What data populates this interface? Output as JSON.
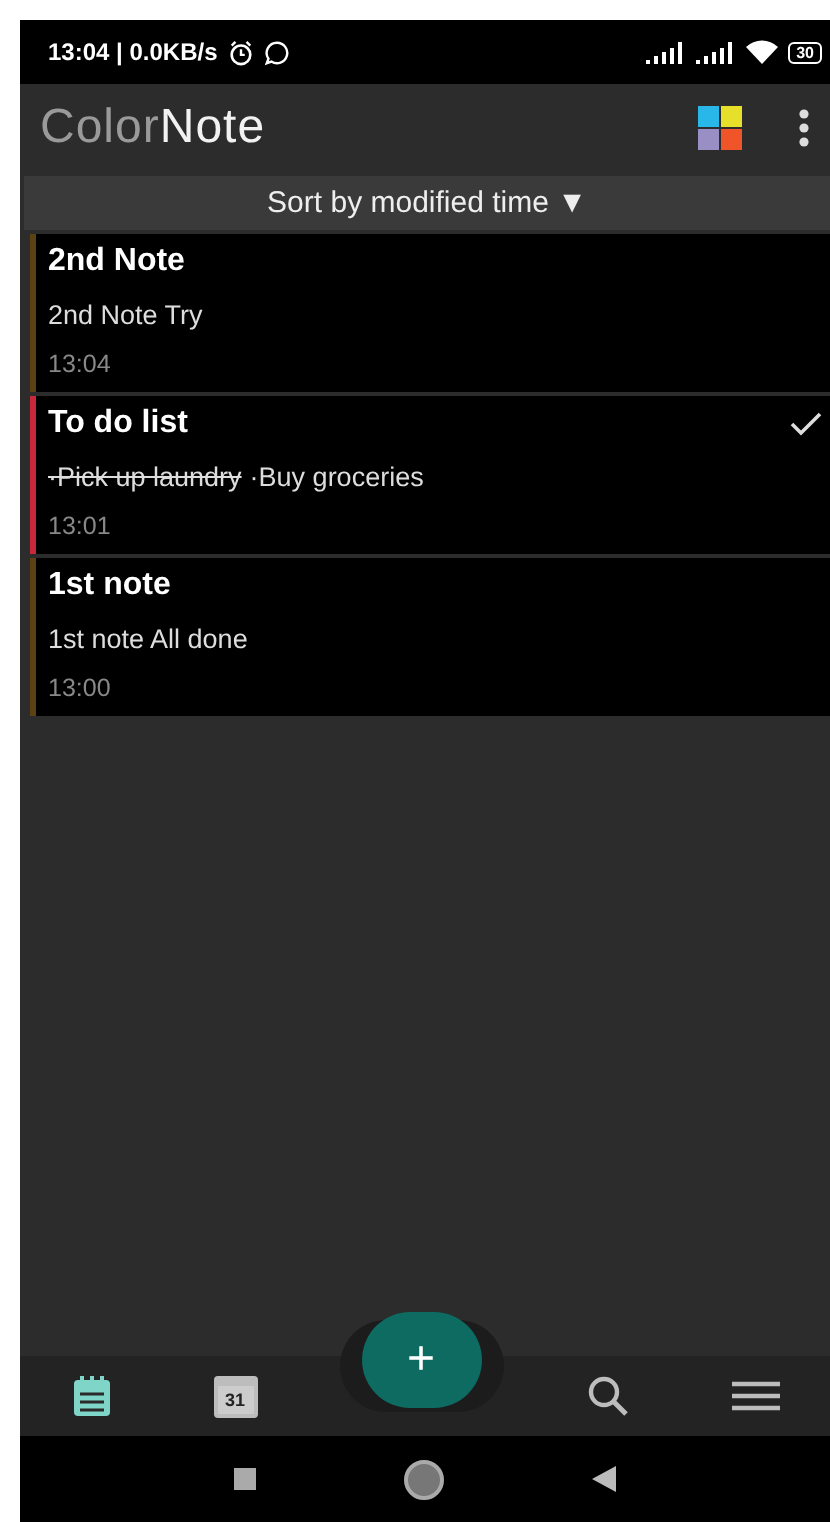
{
  "status_bar": {
    "time": "13:04 | 0.0KB/s",
    "battery": "30"
  },
  "app_bar": {
    "logo_light": "Color",
    "logo_bold": "Note"
  },
  "sort": {
    "label": "Sort by modified time",
    "arrow": "▼"
  },
  "notes": [
    {
      "kind": "text",
      "title": "2nd Note",
      "body": "2nd Note  Try",
      "time": "13:04",
      "color": "#5c4212",
      "checked": false
    },
    {
      "kind": "checklist",
      "title": "To do list",
      "items": [
        {
          "text": "·Pick up laundry",
          "checked": true
        },
        {
          "text": "·Buy groceries",
          "checked": false
        }
      ],
      "time": "13:01",
      "color": "#c8283a",
      "checked": true
    },
    {
      "kind": "text",
      "title": "1st note",
      "body": "1st note  All done",
      "time": "13:00",
      "color": "#5c4212",
      "checked": false
    }
  ],
  "bottom_nav": [
    {
      "kind": "notes",
      "selected": true
    },
    {
      "kind": "calendar",
      "label": "31",
      "selected": false
    },
    {
      "kind": "fab",
      "label": "+",
      "selected": false
    },
    {
      "kind": "search",
      "selected": false
    },
    {
      "kind": "menu",
      "selected": false
    }
  ]
}
